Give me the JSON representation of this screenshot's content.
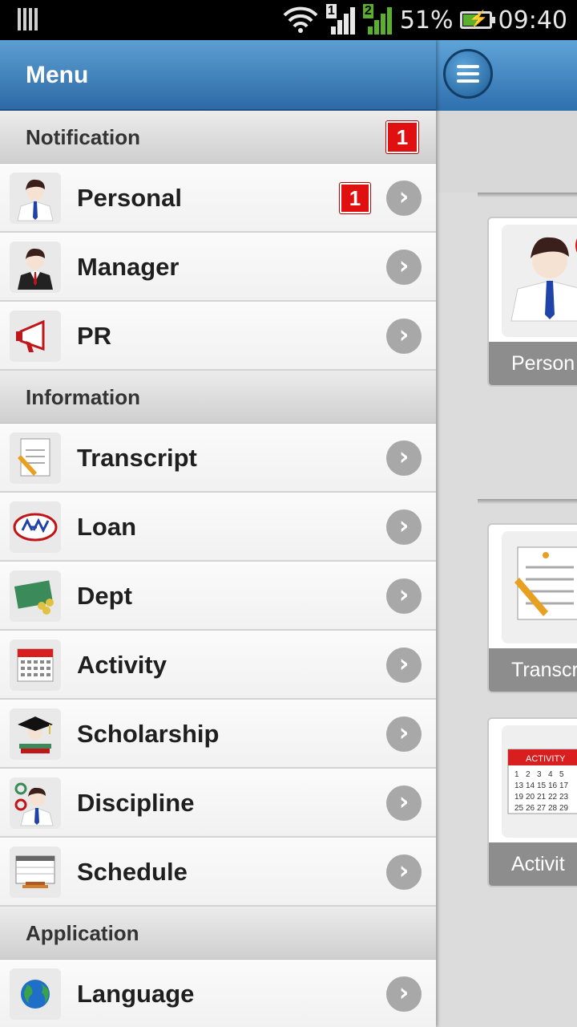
{
  "status_bar": {
    "battery_percent": "51%",
    "time": "09:40",
    "sim1_label": "1",
    "sim2_label": "2"
  },
  "drawer": {
    "title": "Menu",
    "sections": [
      {
        "title": "Notification",
        "badge": "1",
        "items": [
          {
            "label": "Personal",
            "badge": "1",
            "icon": "person-icon"
          },
          {
            "label": "Manager",
            "icon": "manager-icon"
          },
          {
            "label": "PR",
            "icon": "megaphone-icon"
          }
        ]
      },
      {
        "title": "Information",
        "items": [
          {
            "label": "Transcript",
            "icon": "transcript-icon"
          },
          {
            "label": "Loan",
            "icon": "loan-icon"
          },
          {
            "label": "Dept",
            "icon": "dept-icon"
          },
          {
            "label": "Activity",
            "icon": "calendar-icon"
          },
          {
            "label": "Scholarship",
            "icon": "graduation-cap-icon"
          },
          {
            "label": "Discipline",
            "icon": "discipline-icon"
          },
          {
            "label": "Schedule",
            "icon": "schedule-icon"
          }
        ]
      },
      {
        "title": "Application",
        "items": [
          {
            "label": "Language",
            "icon": "globe-icon"
          }
        ]
      }
    ]
  },
  "content": {
    "tiles": [
      {
        "label": "Person",
        "icon": "person-icon"
      },
      {
        "label": "Transcr",
        "icon": "transcript-icon"
      },
      {
        "label": "Activit",
        "icon": "calendar-icon"
      }
    ],
    "calendar_label": "ACTIVITY"
  },
  "colors": {
    "header_blue": "#2d6aa6",
    "badge_red": "#e01010",
    "chevron_gray": "#a8a8a8"
  }
}
